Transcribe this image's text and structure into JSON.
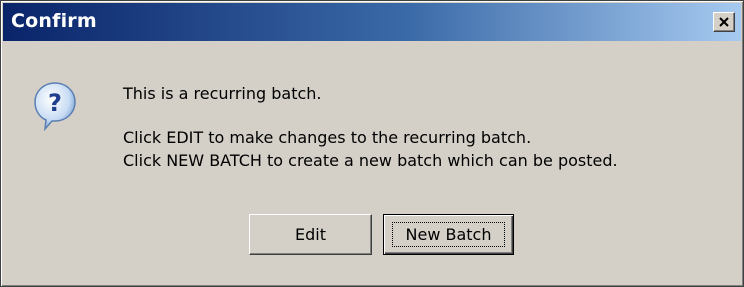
{
  "window": {
    "title": "Confirm",
    "close_icon": "close-icon"
  },
  "icon": {
    "name": "question-icon",
    "glyph": "?"
  },
  "message": {
    "line1": "This is a recurring batch.",
    "line2": "Click EDIT to make changes to the recurring batch.",
    "line3": "Click NEW BATCH to create a new batch which can be posted."
  },
  "buttons": {
    "edit_label": "Edit",
    "new_batch_label": "New Batch"
  },
  "colors": {
    "titlebar_start": "#0a246a",
    "titlebar_end": "#a6caf0",
    "dialog_bg": "#d4d0c8"
  }
}
